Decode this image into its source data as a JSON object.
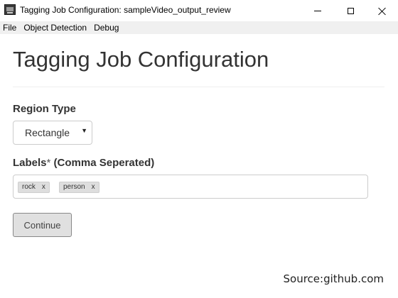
{
  "window": {
    "title": "Tagging Job Configuration: sampleVideo_output_review"
  },
  "menubar": {
    "items": [
      "File",
      "Object Detection",
      "Debug"
    ]
  },
  "page": {
    "title": "Tagging Job Configuration"
  },
  "region_type": {
    "label": "Region Type",
    "selected": "Rectangle"
  },
  "labels_field": {
    "label_main": "Labels",
    "label_star": "*",
    "label_suffix": " (Comma Seperated)",
    "tags": [
      {
        "text": "rock",
        "remove": "x"
      },
      {
        "text": "person",
        "remove": "x"
      }
    ]
  },
  "actions": {
    "continue_label": "Continue"
  },
  "footer": {
    "source": "Source:github.com"
  },
  "icons": {
    "app": "app-icon",
    "minimize": "minimize-icon",
    "maximize": "maximize-icon",
    "close": "close-icon",
    "dropdown": "chevron-down-icon"
  },
  "colors": {
    "menubar_bg": "#f0f0f0",
    "tag_bg": "#dedede",
    "button_bg": "#e0e0e0",
    "text": "#333333"
  }
}
